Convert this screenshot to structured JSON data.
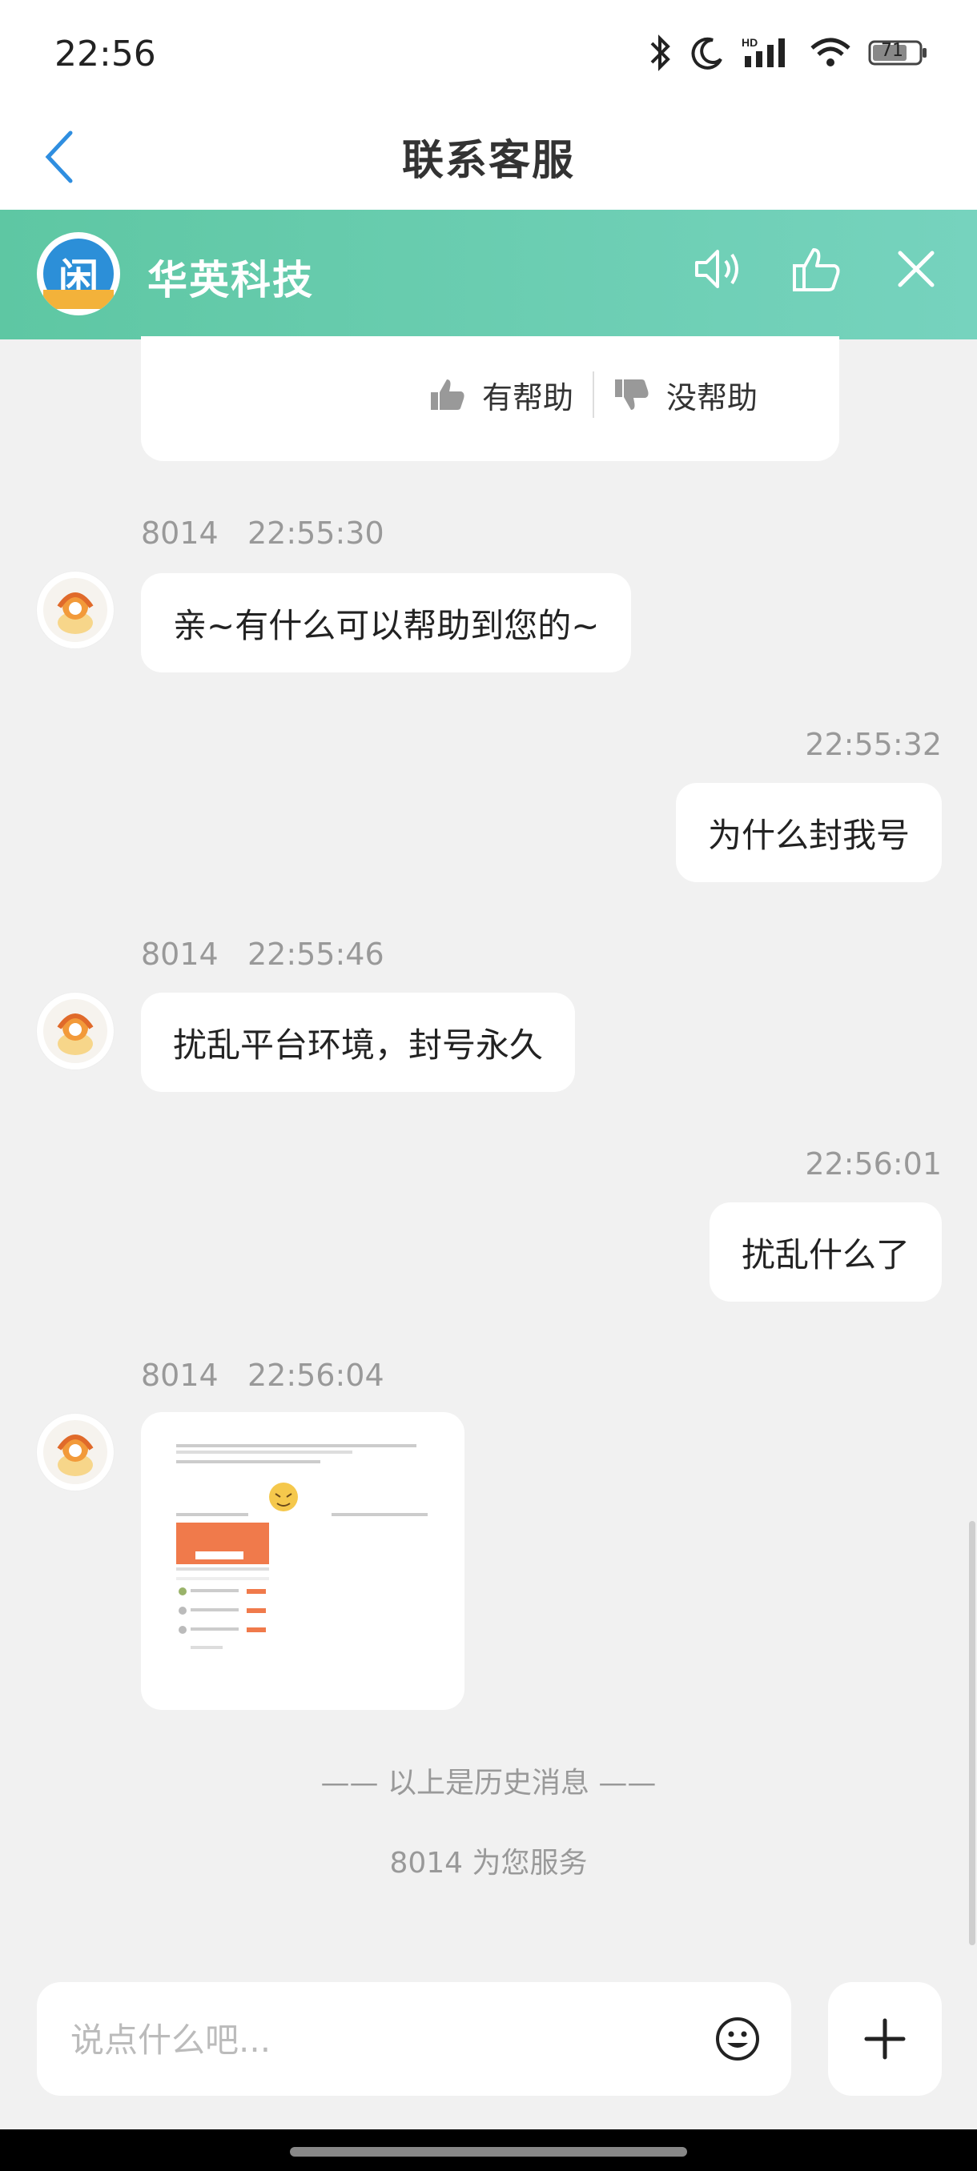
{
  "status": {
    "time": "22:56",
    "battery": "71"
  },
  "nav": {
    "title": "联系客服"
  },
  "banner": {
    "brand": "华英科技",
    "logo_glyph": "闲"
  },
  "feedback": {
    "helpful": "有帮助",
    "unhelpful": "没帮助"
  },
  "messages": [
    {
      "side": "agent",
      "sender": "8014",
      "time": "22:55:30",
      "text": "亲~有什么可以帮助到您的~"
    },
    {
      "side": "user",
      "time": "22:55:32",
      "text": "为什么封我号"
    },
    {
      "side": "agent",
      "sender": "8014",
      "time": "22:55:46",
      "text": "扰乱平台环境，封号永久"
    },
    {
      "side": "user",
      "time": "22:56:01",
      "text": "扰乱什么了"
    },
    {
      "side": "agent",
      "sender": "8014",
      "time": "22:56:04",
      "image": true
    }
  ],
  "history_note": "—— 以上是历史消息 ——",
  "serving_note": "8014 为您服务",
  "composer": {
    "placeholder": "说点什么吧..."
  },
  "colors": {
    "banner": "#5ec7a3",
    "back": "#2f8ee0"
  }
}
